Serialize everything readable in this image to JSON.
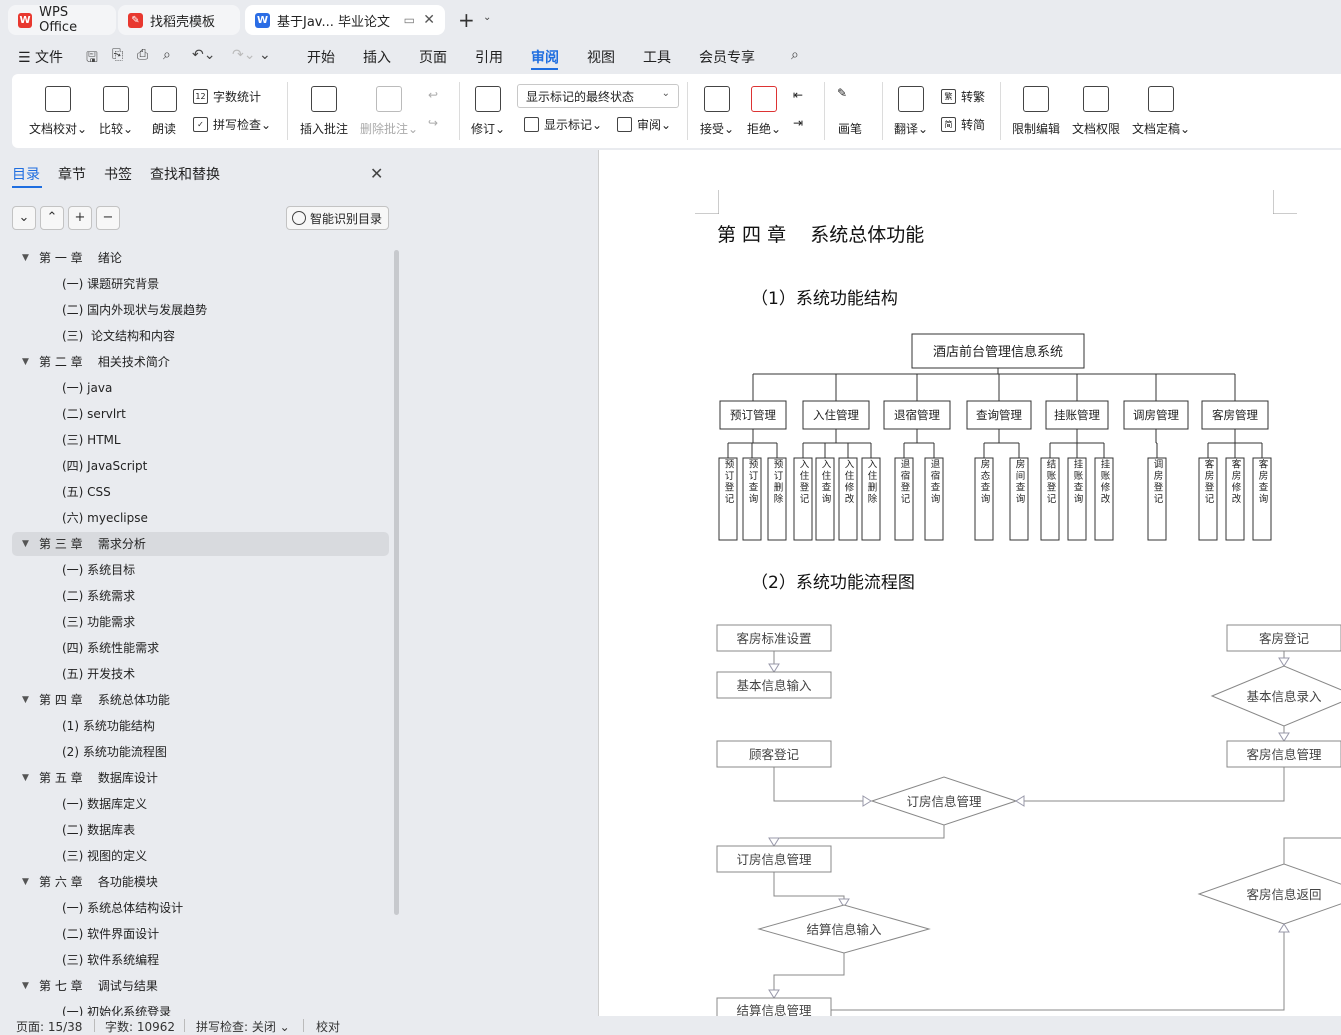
{
  "titlebar": {
    "tabs": [
      {
        "label": "WPS Office"
      },
      {
        "label": "找稻壳模板"
      },
      {
        "label": "基于Jav... 毕业论文"
      }
    ]
  },
  "menubar": {
    "file": "文件",
    "items": [
      "开始",
      "插入",
      "页面",
      "引用",
      "审阅",
      "视图",
      "工具",
      "会员专享"
    ],
    "active": "审阅"
  },
  "ribbon": {
    "doc_proof": "文档校对",
    "compare": "比较",
    "read_aloud": "朗读",
    "word_count": "字数统计",
    "spell_check": "拼写检查",
    "insert_comment": "插入批注",
    "delete_comment": "删除批注",
    "track": "修订",
    "mark_state": "显示标记的最终状态",
    "show_marks": "显示标记",
    "review": "审阅",
    "accept": "接受",
    "reject": "拒绝",
    "pen": "画笔",
    "translate": "翻译",
    "to_trad": "转繁",
    "to_simp": "转简",
    "restrict_edit": "限制编辑",
    "doc_perm": "文档权限",
    "finalize": "文档定稿"
  },
  "sidebar": {
    "tabs": [
      "目录",
      "章节",
      "书签",
      "查找和替换"
    ],
    "smart_toc": "智能识别目录",
    "items": [
      {
        "text": "第 一 章    绪论",
        "level": 1
      },
      {
        "text": "(一) 课题研究背景",
        "level": 2
      },
      {
        "text": "(二) 国内外现状与发展趋势",
        "level": 2
      },
      {
        "text": "(三)  论文结构和内容",
        "level": 2
      },
      {
        "text": "第 二 章    相关技术简介",
        "level": 1
      },
      {
        "text": "(一) java",
        "level": 2
      },
      {
        "text": "(二) servlrt",
        "level": 2
      },
      {
        "text": "(三) HTML",
        "level": 2
      },
      {
        "text": "(四) JavaScript",
        "level": 2
      },
      {
        "text": "(五) CSS",
        "level": 2
      },
      {
        "text": "(六) myeclipse",
        "level": 2
      },
      {
        "text": "第 三 章    需求分析",
        "level": 1,
        "selected": true
      },
      {
        "text": "(一) 系统目标",
        "level": 2
      },
      {
        "text": "(二) 系统需求",
        "level": 2
      },
      {
        "text": "(三) 功能需求",
        "level": 2
      },
      {
        "text": "(四) 系统性能需求",
        "level": 2
      },
      {
        "text": "(五) 开发技术",
        "level": 2
      },
      {
        "text": "第 四 章    系统总体功能",
        "level": 1
      },
      {
        "text": "(1) 系统功能结构",
        "level": 2
      },
      {
        "text": "(2) 系统功能流程图",
        "level": 2
      },
      {
        "text": "第 五 章    数据库设计",
        "level": 1
      },
      {
        "text": "(一) 数据库定义",
        "level": 2
      },
      {
        "text": "(二) 数据库表",
        "level": 2
      },
      {
        "text": "(三) 视图的定义",
        "level": 2
      },
      {
        "text": "第 六 章    各功能模块",
        "level": 1
      },
      {
        "text": "(一) 系统总体结构设计",
        "level": 2
      },
      {
        "text": "(二) 软件界面设计",
        "level": 2
      },
      {
        "text": "(三) 软件系统编程",
        "level": 2
      },
      {
        "text": "第 七 章    调试与结果",
        "level": 1
      },
      {
        "text": "(一) 初始化系统登录",
        "level": 2
      }
    ]
  },
  "document": {
    "chapter_title": "第 四 章    系统总体功能",
    "section1": "（1）系统功能结构",
    "section2": "（2）系统功能流程图",
    "structure": {
      "root": "酒店前台管理信息系统",
      "modules": [
        {
          "name": "预订管理",
          "subs": [
            "预订登记",
            "预订查询",
            "预订删除"
          ]
        },
        {
          "name": "入住管理",
          "subs": [
            "入住登记",
            "入住查询",
            "入住修改",
            "入住删除"
          ]
        },
        {
          "name": "退宿管理",
          "subs": [
            "退宿登记",
            "退宿查询"
          ]
        },
        {
          "name": "查询管理",
          "subs": [
            "房态查询",
            "房间查询"
          ]
        },
        {
          "name": "挂账管理",
          "subs": [
            "结账登记",
            "挂账查询",
            "挂账修改"
          ]
        },
        {
          "name": "调房管理",
          "subs": [
            "调房登记"
          ]
        },
        {
          "name": "客房管理",
          "subs": [
            "客房登记",
            "客房修改",
            "客房查询"
          ]
        }
      ]
    },
    "flow": {
      "room_standard": "客房标准设置",
      "basic_input": "基本信息输入",
      "room_register": "客房登记",
      "basic_record": "基本信息录入",
      "guest_register": "顾客登记",
      "room_info_mgmt": "客房信息管理",
      "booking_mgmt_diamond": "订房信息管理",
      "booking_mgmt_box": "订房信息管理",
      "room_return": "客房信息返回",
      "checkout_input": "结算信息输入",
      "checkout_mgmt": "结算信息管理"
    }
  },
  "statusbar": {
    "page": "页面: 15/38",
    "words": "字数: 10962",
    "spell": "拼写检查: 关闭",
    "proof": "校对"
  }
}
